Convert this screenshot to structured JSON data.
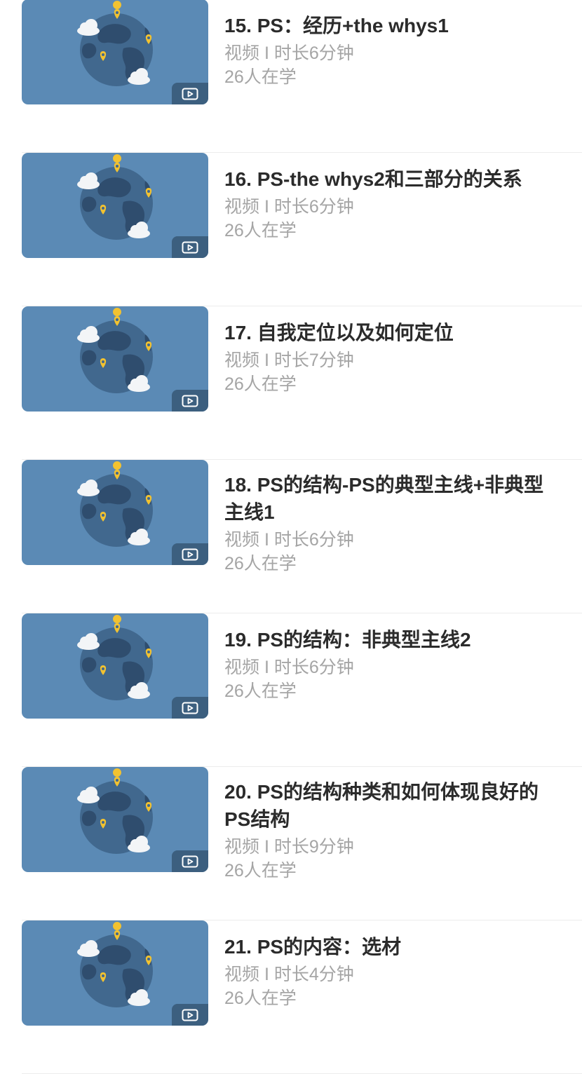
{
  "courses": [
    {
      "title": "15. PS：经历+the whys1",
      "meta": "视频 I 时长6分钟",
      "learners": "26人在学"
    },
    {
      "title": "16. PS-the whys2和三部分的关系",
      "meta": "视频 I 时长6分钟",
      "learners": "26人在学"
    },
    {
      "title": "17. 自我定位以及如何定位",
      "meta": "视频 I 时长7分钟",
      "learners": "26人在学"
    },
    {
      "title": "18. PS的结构-PS的典型主线+非典型主线1",
      "meta": "视频 I 时长6分钟",
      "learners": "26人在学"
    },
    {
      "title": "19. PS的结构：非典型主线2",
      "meta": "视频 I 时长6分钟",
      "learners": "26人在学"
    },
    {
      "title": "20. PS的结构种类和如何体现良好的PS结构",
      "meta": "视频 I 时长9分钟",
      "learners": "26人在学"
    },
    {
      "title": "21. PS的内容：选材",
      "meta": "视频 I 时长4分钟",
      "learners": "26人在学"
    }
  ],
  "colors": {
    "thumb_bg": "#5b8ab5",
    "globe_light": "#41688e",
    "globe_dark": "#2f4d6e",
    "pin": "#f2c230",
    "cloud": "#f3f5f7",
    "badge_bg": "#3c5f7f"
  },
  "icons": {
    "thumbnail": "globe-illustration",
    "badge": "video-play-icon"
  }
}
